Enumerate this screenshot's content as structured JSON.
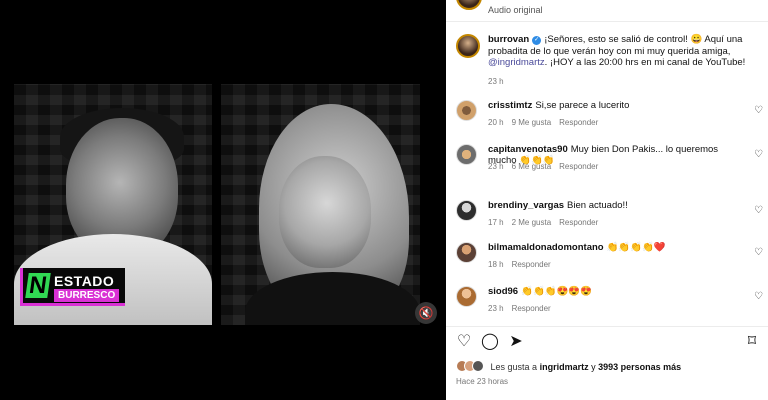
{
  "post": {
    "audio_label": "Audio original",
    "caption": {
      "username": "burrovan",
      "verified_icon": "✓",
      "before_mention": "¡Señores, esto se salió de control! 😀 Aquí una probadita de lo que verán hoy con mi muy querida amiga,",
      "mention": "@ingridmartz",
      "after_mention": ". ¡HOY a las 20:00 hrs en mi canal de YouTube!",
      "time": "23 h"
    },
    "comments": [
      {
        "username": "crisstimtz",
        "text": "Si,se parece a lucerito",
        "time": "20 h",
        "likes": "9 Me gusta",
        "reply": "Responder"
      },
      {
        "username": "capitanvenotas90",
        "text": "Muy bien Don Pakis... lo queremos mucho 👏👏👏",
        "time": "23 h",
        "likes": "6 Me gusta",
        "reply": "Responder"
      },
      {
        "username": "brendiny_vargas",
        "text": "Bien actuado!!",
        "time": "17 h",
        "likes": "2 Me gusta",
        "reply": "Responder"
      },
      {
        "username": "bilmamaldonadomontano",
        "text": "👏👏👏👏❤️",
        "time": "18 h",
        "likes": "",
        "reply": "Responder"
      },
      {
        "username": "siod96",
        "text": "👏👏👏😍😍😍",
        "time": "23 h",
        "likes": "",
        "reply": "Responder"
      }
    ],
    "likes_text_prefix": "Les gusta a",
    "likes_user": "ingridmartz",
    "likes_text_middle": "y",
    "likes_count": "3993 personas más",
    "posted": "Hace 23 horas"
  },
  "media": {
    "brand_mark": "N",
    "brand_top": "ESTADO",
    "brand_bottom": "BURRESCO",
    "mute_icon": "🔇"
  },
  "icons": {
    "like": "♡",
    "comment": "◯",
    "share": "➤",
    "save": "⌑",
    "comment_heart": "♡"
  },
  "colors": {
    "verified": "#2f8ce5",
    "brand_green": "#31d853",
    "brand_magenta": "#d931d4"
  }
}
